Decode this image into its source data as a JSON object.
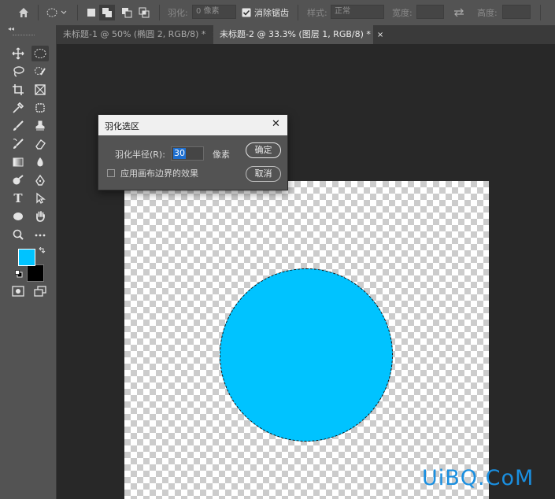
{
  "options_bar": {
    "feather_label": "羽化:",
    "feather_value": "0 像素",
    "antialias_label": "消除锯齿",
    "style_label": "样式:",
    "style_value": "正常",
    "width_label": "宽度:",
    "height_label": "高度:"
  },
  "tabs": [
    {
      "label": "未标题-1 @ 50% (椭圆 2, RGB/8) *",
      "close": "×",
      "active": false
    },
    {
      "label": "未标题-2 @ 33.3% (图层 1, RGB/8) *",
      "close": "×",
      "active": true
    }
  ],
  "toolbar": {
    "collapse_glyph": "◂◂",
    "foreground_color": "#00c3ff",
    "background_color": "#000000"
  },
  "dialog": {
    "title": "羽化选区",
    "close": "✕",
    "radius_label": "羽化半径(R):",
    "radius_value": "30",
    "unit": "像素",
    "checkbox_label": "应用画布边界的效果",
    "ok_label": "确定",
    "cancel_label": "取消"
  },
  "canvas": {
    "shape_color": "#00c3ff"
  },
  "watermark": "UiBQ.CoM"
}
